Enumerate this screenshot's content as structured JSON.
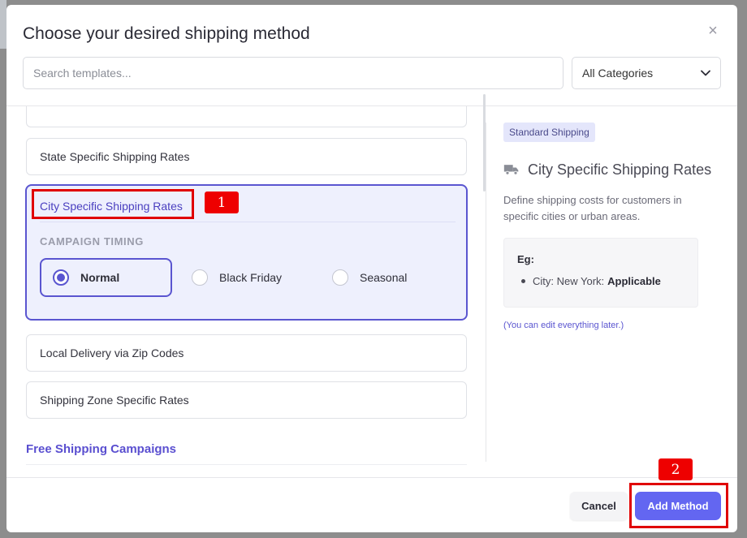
{
  "modal": {
    "title": "Choose your desired shipping method",
    "close_glyph": "×"
  },
  "search": {
    "placeholder": "Search templates...",
    "value": ""
  },
  "category_filter": {
    "selected": "All Categories",
    "icon": "chevron-down-icon"
  },
  "options": [
    {
      "label": "State Specific Shipping Rates",
      "selected": false
    },
    {
      "label": "City Specific Shipping Rates",
      "selected": true
    },
    {
      "label": "Local Delivery via Zip Codes",
      "selected": false
    },
    {
      "label": "Shipping Zone Specific Rates",
      "selected": false
    }
  ],
  "campaign_timing": {
    "label": "CAMPAIGN TIMING",
    "options": [
      {
        "label": "Normal",
        "checked": true
      },
      {
        "label": "Black Friday",
        "checked": false
      },
      {
        "label": "Seasonal",
        "checked": false
      }
    ]
  },
  "section_heading": "Free Shipping Campaigns",
  "detail": {
    "badge": "Standard Shipping",
    "icon": "truck-icon",
    "title": "City Specific Shipping Rates",
    "description": "Define shipping costs for customers in specific cities or urban areas.",
    "example_label": "Eg:",
    "example_key": "City: New York:",
    "example_value": "Applicable",
    "note": "(You can edit everything later.)"
  },
  "footer": {
    "cancel_label": "Cancel",
    "add_label": "Add Method"
  },
  "annotations": [
    {
      "number": "1"
    },
    {
      "number": "2"
    }
  ],
  "colors": {
    "accent": "#6366f1",
    "selected_border": "#5a55d0",
    "selected_bg": "#eef0fd",
    "annotation_red": "#e00000"
  }
}
